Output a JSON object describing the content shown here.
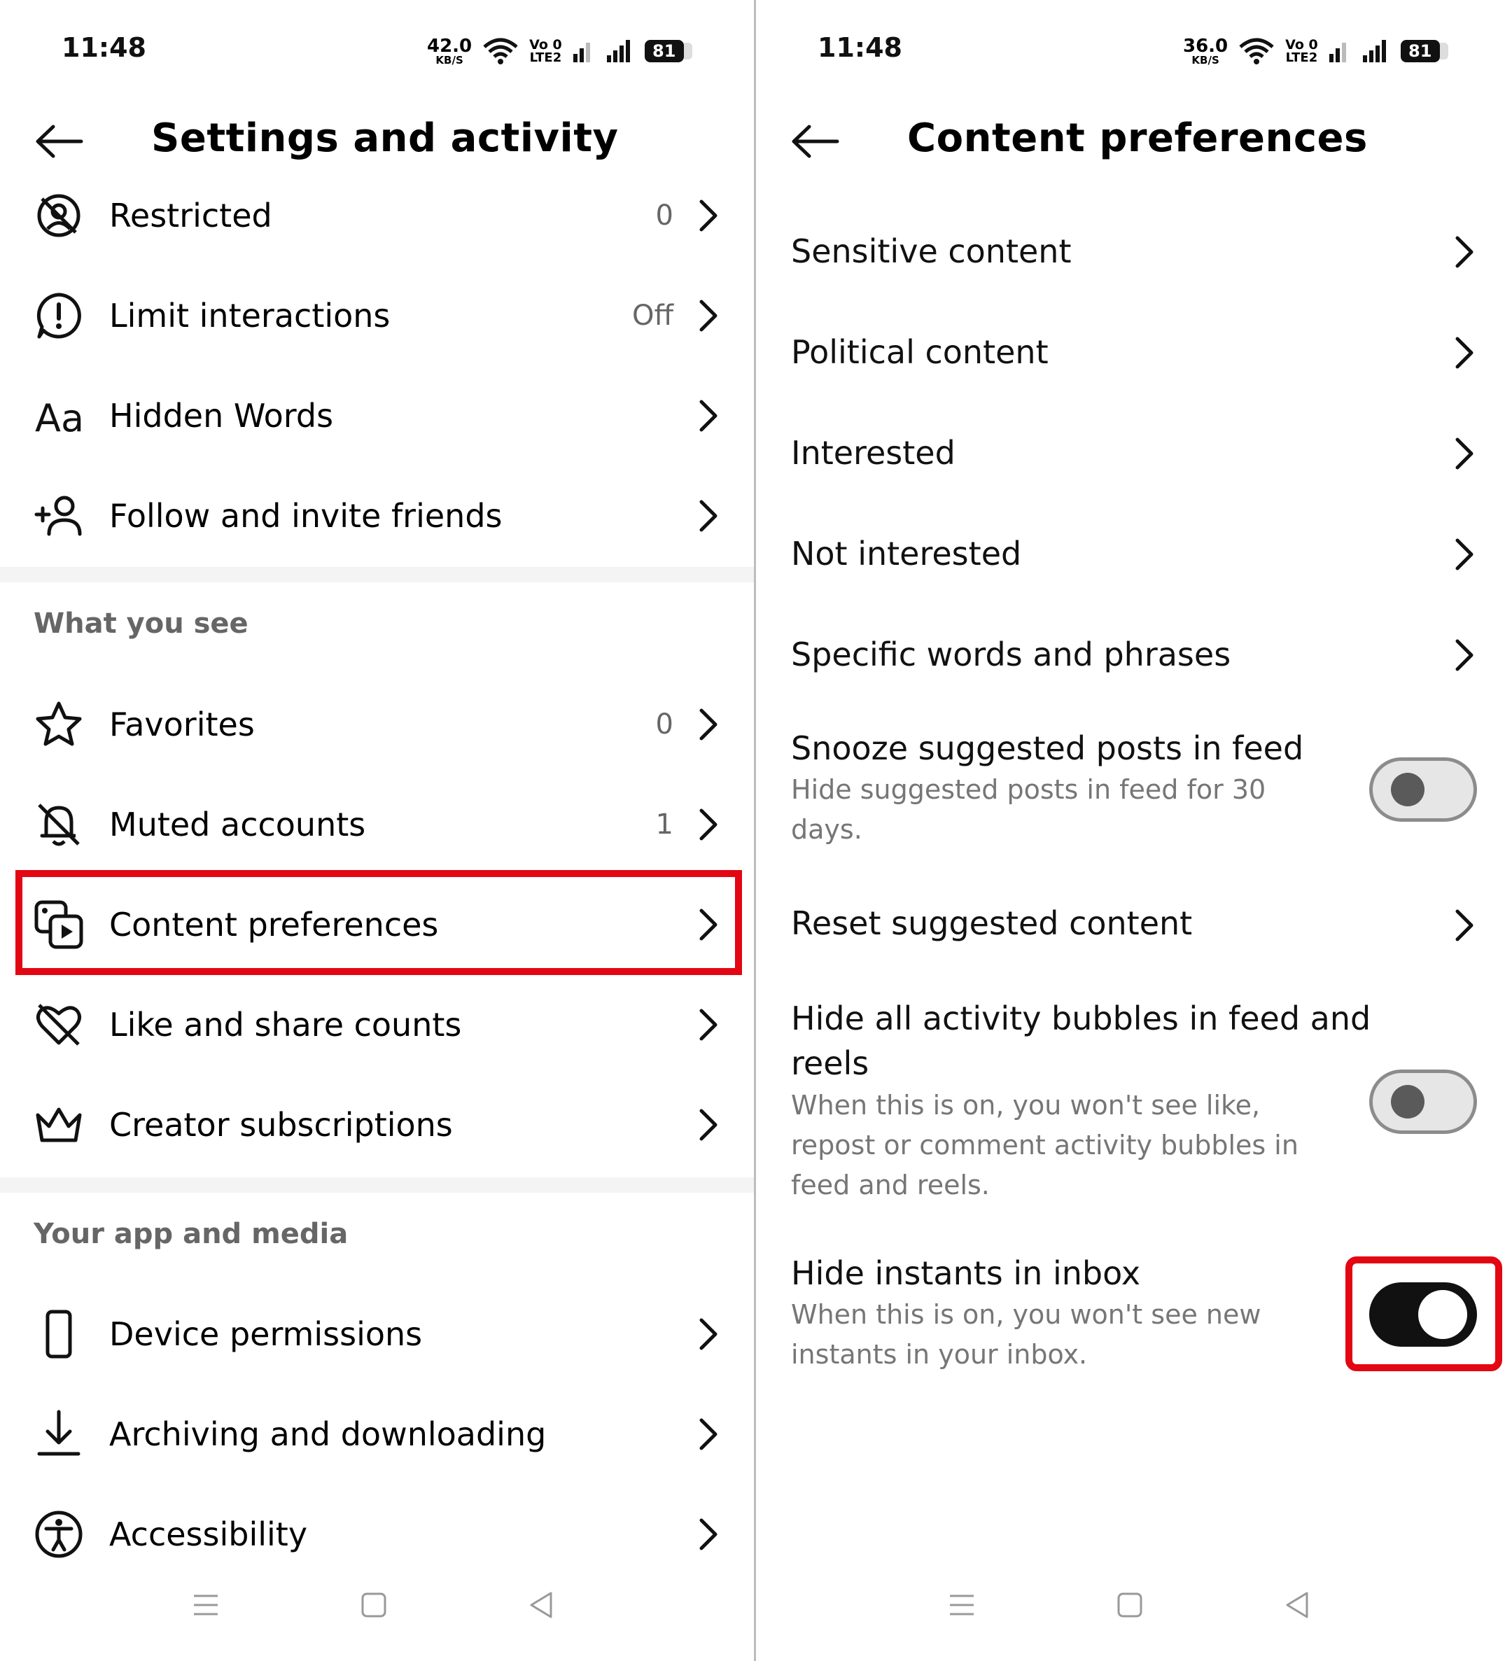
{
  "left": {
    "status": {
      "time": "11:48",
      "speed_value": "42.0",
      "speed_unit": "KB/S",
      "volte_top": "Vo 0",
      "volte_bottom": "LTE2",
      "battery": "81"
    },
    "header": {
      "title": "Settings and activity"
    },
    "items_top": [
      {
        "label": "Restricted",
        "value": "0",
        "icon": "restricted-icon"
      },
      {
        "label": "Limit interactions",
        "value": "Off",
        "icon": "limit-interactions-icon"
      },
      {
        "label": "Hidden Words",
        "value": "",
        "icon": "hidden-words-icon"
      },
      {
        "label": "Follow and invite friends",
        "value": "",
        "icon": "add-person-icon"
      }
    ],
    "section_what_you_see": "What you see",
    "items_what_you_see": [
      {
        "label": "Favorites",
        "value": "0",
        "icon": "star-icon"
      },
      {
        "label": "Muted accounts",
        "value": "1",
        "icon": "muted-bell-icon"
      },
      {
        "label": "Content preferences",
        "value": "",
        "icon": "content-preferences-icon"
      },
      {
        "label": "Like and share counts",
        "value": "",
        "icon": "heart-off-icon"
      },
      {
        "label": "Creator subscriptions",
        "value": "",
        "icon": "crown-icon"
      }
    ],
    "section_app_media": "Your app and media",
    "items_app_media": [
      {
        "label": "Device permissions",
        "value": "",
        "icon": "phone-icon"
      },
      {
        "label": "Archiving and downloading",
        "value": "",
        "icon": "download-icon"
      },
      {
        "label": "Accessibility",
        "value": "",
        "icon": "accessibility-icon"
      }
    ]
  },
  "right": {
    "status": {
      "time": "11:48",
      "speed_value": "36.0",
      "speed_unit": "KB/S",
      "volte_top": "Vo 0",
      "volte_bottom": "LTE2",
      "battery": "81"
    },
    "header": {
      "title": "Content preferences"
    },
    "items": [
      {
        "label": "Sensitive content"
      },
      {
        "label": "Political content"
      },
      {
        "label": "Interested"
      },
      {
        "label": "Not interested"
      },
      {
        "label": "Specific words and phrases"
      }
    ],
    "snooze": {
      "label": "Snooze suggested posts in feed",
      "desc_line1": "Hide suggested posts in feed for 30",
      "desc_line2": "days.",
      "enabled": false
    },
    "reset": {
      "label": "Reset suggested content"
    },
    "hide_bubbles": {
      "label_line1": "Hide all activity bubbles in feed and",
      "label_line2": "reels",
      "desc_line1": "When this is on, you won't see like,",
      "desc_line2": "repost or comment activity bubbles in",
      "desc_line3": "feed and reels.",
      "enabled": false
    },
    "hide_instants": {
      "label": "Hide instants in inbox",
      "desc_line1": "When this is on, you won't see new",
      "desc_line2": "instants in your inbox.",
      "enabled": true
    }
  },
  "colors": {
    "highlight": "#e30613",
    "toggle_on": "#111111",
    "secondary_text": "#767676"
  }
}
